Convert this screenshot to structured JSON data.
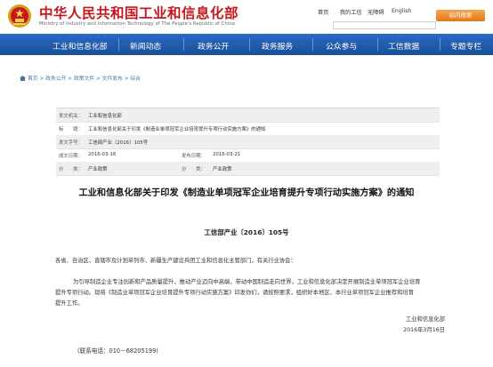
{
  "header": {
    "title": "中华人民共和国工业和信息化部",
    "subtitle": "Ministry of Industry and Information Technology of The People's Republic of China",
    "links": [
      "首页",
      "我的工信",
      "无障碍",
      "English"
    ],
    "search_placeholder": "",
    "search_button": "站内搜索"
  },
  "nav": {
    "items": [
      "工业和信息化部",
      "新闻动态",
      "政务公开",
      "政务服务",
      "公众参与",
      "工信数据",
      "专题专栏"
    ]
  },
  "breadcrumb": {
    "items": [
      "首页",
      "政务公开",
      "政策文件",
      "文件发布",
      "综合"
    ],
    "separator": ">"
  },
  "meta": {
    "sender_label": "发文机关：",
    "sender_value": "工业和信息化部",
    "subject_label": "标　　题：",
    "subject_value": "工业和信息化部关于印发《制造业单项冠军企业培育提升专项行动实施方案》的通知",
    "docnum_label": "发文字号：",
    "docnum_value": "工信部产业〔2016〕105号",
    "date_label": "成文日期：",
    "date_value": "2016-03-16",
    "pubdate_label": "发布日期：",
    "pubdate_value": "2016-03-21",
    "category_label": "分　　类：",
    "category_value": "产业政策",
    "category2_label": "分　　类：",
    "category2_value": "产业政策"
  },
  "article": {
    "title": "工业和信息化部关于印发《制造业单项冠军企业培育提升专项行动实施方案》的通知",
    "doc_number": "工信部产业〔2016〕105号",
    "addressee": "各省、自治区、直辖市及计划单列市、新疆生产建设兵团工业和信息化主管部门，有关行业协会：",
    "body_line1": "为引导制造企业专注创新和产品质量提升，推动产业迈向中高端，带动中国制造走向世界，工业和信息化部决定开展制造业单项冠军企业培育",
    "body_line2": "提升专项行动。现将《制造业单项冠军企业培育提升专项行动实施方案》印发你们，请按照要求，组织好本地区、本行业单项冠军企业推荐和培育",
    "body_line3": "提升工作。",
    "signer": "工业和信息化部",
    "sign_date": "2016年3月16日",
    "contact": "(联系电话：010－68205199)"
  }
}
